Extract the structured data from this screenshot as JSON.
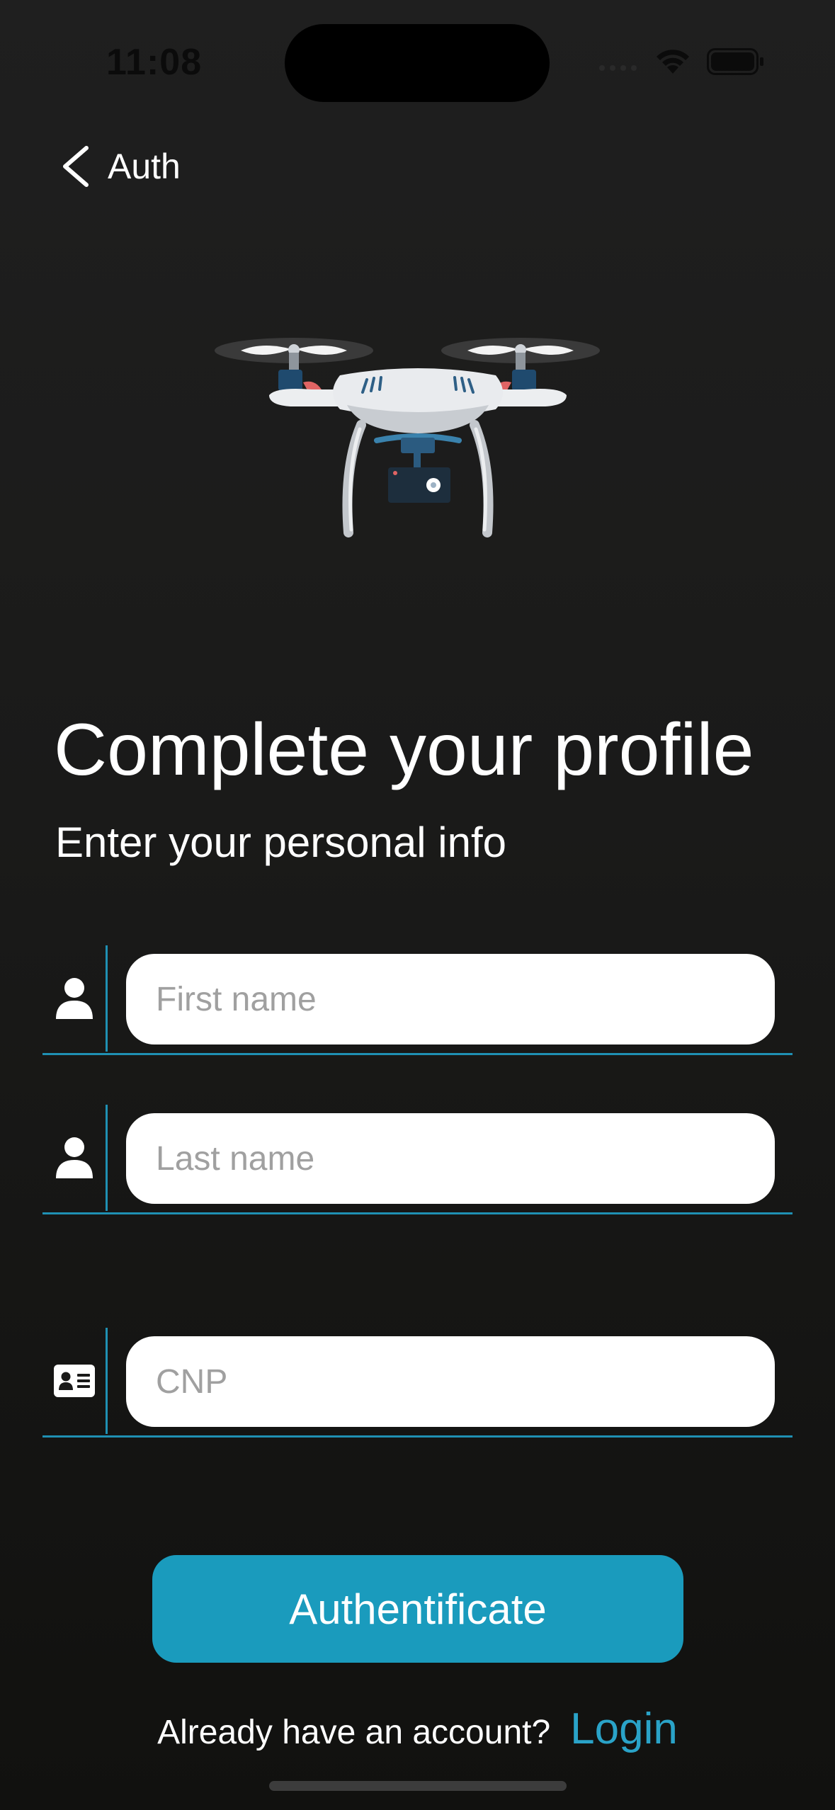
{
  "status_bar": {
    "time": "11:08",
    "icons": [
      "signal-icon",
      "wifi-icon",
      "battery-icon"
    ]
  },
  "nav": {
    "back_label": "Auth",
    "back_icon": "chevron-left-icon"
  },
  "illustration": {
    "name": "drone-illustration"
  },
  "header": {
    "title": "Complete your profile",
    "subtitle": "Enter your personal info"
  },
  "form": {
    "fields": [
      {
        "name": "first-name-input",
        "icon": "person-icon",
        "placeholder": "First name",
        "value": ""
      },
      {
        "name": "last-name-input",
        "icon": "person-icon",
        "placeholder": "Last name",
        "value": ""
      },
      {
        "name": "cnp-input",
        "icon": "id-card-icon",
        "placeholder": "CNP",
        "value": ""
      }
    ],
    "submit_label": "Authentificate"
  },
  "footer": {
    "prompt": "Already have an account?",
    "login_label": "Login"
  },
  "colors": {
    "accent": "#1a9bbd",
    "link": "#2aa3c8",
    "background": "#1a1a19",
    "input_background": "#ffffff"
  }
}
